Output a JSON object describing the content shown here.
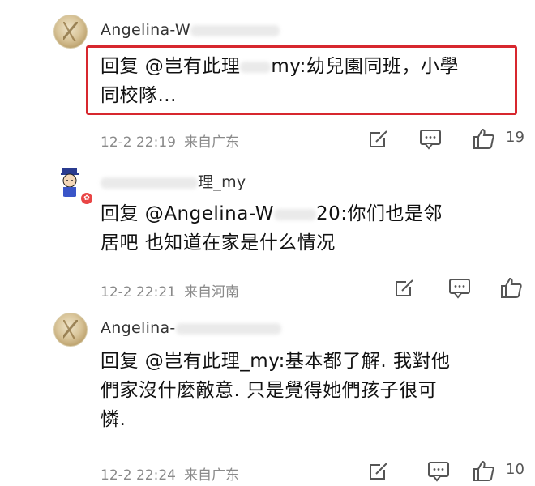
{
  "comments": [
    {
      "username": "Angelina-W",
      "reply_prefix": "回复 @",
      "reply_target": "岂有此理",
      "reply_target_tail": "my",
      "text_line1": ":幼兒園同班，小學",
      "text_line2": "同校隊...",
      "time": "12-2 22:19",
      "location": "来自广东",
      "like_count": "19"
    },
    {
      "username": "理_my",
      "reply_prefix": "回复 @",
      "reply_target": "Angelina-W",
      "reply_target_tail": "20",
      "text_line1": ":你们也是邻",
      "text_line2": "居吧 也知道在家是什么情况",
      "time": "12-2 22:21",
      "location": "来自河南",
      "like_count": ""
    },
    {
      "username": "Angelina-",
      "reply_line1": "回复 @岂有此理_my:基本都了解. 我對他",
      "reply_line2": "們家沒什麼敵意. 只是覺得她們孩子很可",
      "reply_line3": "憐.",
      "time": "12-2 22:24",
      "location": "来自广东",
      "like_count": "10"
    }
  ],
  "icons": {
    "share": "share-edit-icon",
    "comment": "comment-bubble-icon",
    "like": "thumbs-up-icon"
  },
  "colors": {
    "highlight_border": "#d7272e",
    "meta_text": "#8a8a8a"
  }
}
